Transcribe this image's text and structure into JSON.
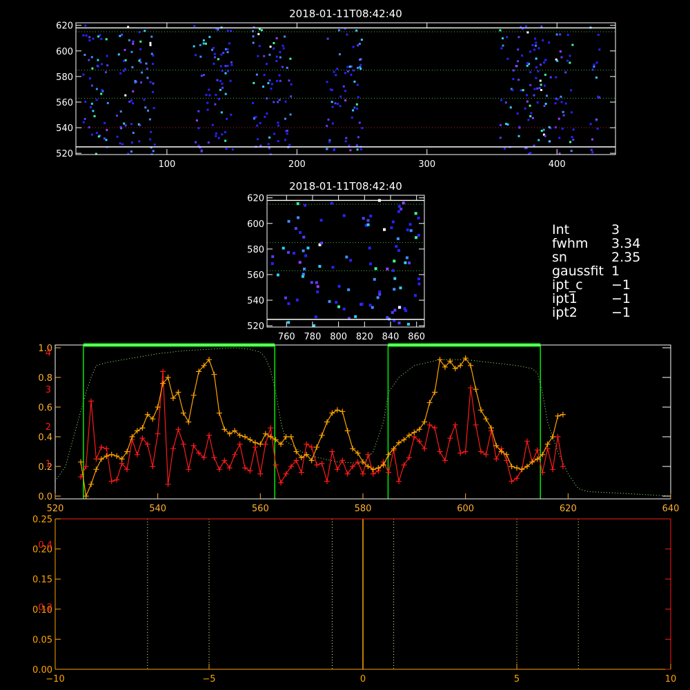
{
  "colors": {
    "background": "#000000",
    "axes": "#ffffff",
    "orange": "#ffa500",
    "red": "#ff1a1a",
    "green": "#00ff00",
    "green_dotted": "#a8ff7a",
    "red_dotted": "#cc2222",
    "yellow_dotted": "#ffff99",
    "amber_axis": "#ffb030"
  },
  "info": {
    "rows": [
      {
        "key": "Int",
        "value": "3"
      },
      {
        "key": "fwhm",
        "value": "3.34"
      },
      {
        "key": "sn",
        "value": "2.35"
      },
      {
        "key": "gaussfit",
        "value": "1"
      },
      {
        "key": "ipt_c",
        "value": "−1"
      },
      {
        "key": "ipt1",
        "value": "−1"
      },
      {
        "key": "ipt2",
        "value": "−1"
      }
    ]
  },
  "chart_data": [
    {
      "type": "heatmap",
      "title": "2018-01-11T08:42:40",
      "xlim": [
        30,
        445
      ],
      "ylim": [
        519,
        622
      ],
      "x_ticks": [
        100,
        200,
        300,
        400
      ],
      "y_ticks": [
        520,
        540,
        560,
        580,
        600,
        620
      ],
      "white_lines_y": [
        525,
        618
      ],
      "green_dotted_y": [
        563,
        585,
        615
      ],
      "red_dotted_y": [
        540
      ],
      "pixel_columns": [
        [
          35,
          55
        ],
        [
          60,
          90
        ],
        [
          120,
          150
        ],
        [
          165,
          195
        ],
        [
          222,
          250
        ],
        [
          355,
          395
        ],
        [
          398,
          412
        ],
        [
          425,
          432
        ]
      ]
    },
    {
      "type": "heatmap",
      "title": "2018-01-11T08:42:40",
      "xlim": [
        745,
        866
      ],
      "ylim": [
        519,
        622
      ],
      "x_ticks": [
        760,
        780,
        800,
        820,
        840,
        860
      ],
      "y_ticks": [
        520,
        540,
        560,
        580,
        600,
        620
      ],
      "white_lines_y": [
        525,
        618
      ],
      "green_dotted_y": [
        563,
        585,
        615
      ]
    },
    {
      "type": "line",
      "xlim": [
        520,
        640
      ],
      "ylim": [
        0,
        1.0
      ],
      "x_ticks": [
        520,
        540,
        560,
        580,
        600,
        620,
        640
      ],
      "y_ticks": [
        "0.0",
        "0.2",
        "0.4",
        "0.6",
        "0.8",
        "1.0"
      ],
      "right_axis_red_ticks": [
        {
          "label": "1",
          "at": 0.22
        },
        {
          "label": "2",
          "at": 0.47
        },
        {
          "label": "3",
          "at": 0.72
        },
        {
          "label": "4",
          "at": 0.97
        }
      ],
      "green_bands": [
        [
          525.5,
          562.8
        ],
        [
          584.9,
          614.6
        ]
      ],
      "orange_series": {
        "x": [
          525,
          526,
          527,
          528,
          529,
          530,
          531,
          532,
          533,
          534,
          535,
          536,
          537,
          538,
          539,
          540,
          541,
          542,
          543,
          544,
          545,
          546,
          547,
          548,
          549,
          550,
          551,
          552,
          553,
          554,
          555,
          556,
          557,
          558,
          559,
          560,
          561,
          562,
          563,
          564,
          565,
          566,
          567,
          568,
          569,
          570,
          571,
          572,
          573,
          574,
          575,
          576,
          577,
          578,
          579,
          580,
          581,
          582,
          583,
          584,
          585,
          586,
          587,
          588,
          589,
          590,
          591,
          592,
          593,
          594,
          595,
          596,
          597,
          598,
          599,
          600,
          601,
          602,
          603,
          604,
          605,
          606,
          607,
          608,
          609,
          610,
          611,
          612,
          613,
          614,
          615,
          616,
          617,
          618,
          619
        ],
        "y": [
          0.23,
          0.0,
          0.08,
          0.18,
          0.25,
          0.27,
          0.28,
          0.27,
          0.25,
          0.3,
          0.4,
          0.44,
          0.46,
          0.55,
          0.52,
          0.6,
          0.76,
          0.8,
          0.66,
          0.7,
          0.56,
          0.5,
          0.68,
          0.84,
          0.88,
          0.92,
          0.82,
          0.56,
          0.45,
          0.42,
          0.44,
          0.41,
          0.4,
          0.38,
          0.36,
          0.35,
          0.42,
          0.4,
          0.38,
          0.35,
          0.4,
          0.4,
          0.3,
          0.26,
          0.28,
          0.24,
          0.33,
          0.41,
          0.5,
          0.56,
          0.58,
          0.57,
          0.44,
          0.32,
          0.29,
          0.23,
          0.2,
          0.18,
          0.19,
          0.21,
          0.28,
          0.32,
          0.36,
          0.38,
          0.41,
          0.43,
          0.45,
          0.5,
          0.63,
          0.7,
          0.92,
          0.87,
          0.91,
          0.86,
          0.88,
          0.93,
          0.88,
          0.72,
          0.58,
          0.52,
          0.46,
          0.34,
          0.3,
          0.28,
          0.2,
          0.19,
          0.18,
          0.2,
          0.23,
          0.25,
          0.28,
          0.35,
          0.4,
          0.54,
          0.55
        ]
      },
      "red_series": {
        "x": [
          525,
          526,
          527,
          528,
          529,
          530,
          531,
          532,
          533,
          534,
          535,
          536,
          537,
          538,
          539,
          540,
          541,
          542,
          543,
          544,
          545,
          546,
          547,
          548,
          549,
          550,
          551,
          552,
          553,
          554,
          555,
          556,
          557,
          558,
          559,
          560,
          561,
          562,
          563,
          564,
          565,
          566,
          567,
          568,
          569,
          570,
          571,
          572,
          573,
          574,
          575,
          576,
          577,
          578,
          579,
          580,
          581,
          582,
          583,
          584,
          585,
          586,
          587,
          588,
          589,
          590,
          591,
          592,
          593,
          594,
          595,
          596,
          597,
          598,
          599,
          600,
          601,
          602,
          603,
          604,
          605,
          606,
          607,
          608,
          609,
          610,
          611,
          612,
          613,
          614,
          615,
          616,
          617,
          618,
          619
        ],
        "y": [
          0.13,
          0.2,
          0.64,
          0.25,
          0.33,
          0.32,
          0.1,
          0.11,
          0.22,
          0.18,
          0.38,
          0.28,
          0.39,
          0.35,
          0.2,
          0.42,
          0.84,
          0.08,
          0.32,
          0.45,
          0.35,
          0.18,
          0.34,
          0.29,
          0.26,
          0.41,
          0.26,
          0.18,
          0.24,
          0.19,
          0.28,
          0.35,
          0.19,
          0.17,
          0.33,
          0.15,
          0.35,
          0.46,
          0.21,
          0.09,
          0.15,
          0.2,
          0.24,
          0.16,
          0.35,
          0.33,
          0.21,
          0.22,
          0.1,
          0.3,
          0.18,
          0.24,
          0.15,
          0.2,
          0.23,
          0.15,
          0.28,
          0.15,
          0.17,
          0.23,
          0.16,
          0.31,
          0.1,
          0.21,
          0.26,
          0.4,
          0.37,
          0.32,
          0.48,
          0.46,
          0.3,
          0.24,
          0.39,
          0.48,
          0.29,
          0.3,
          0.73,
          0.48,
          0.3,
          0.28,
          0.44,
          0.25,
          0.32,
          0.24,
          0.1,
          0.12,
          0.18,
          0.37,
          0.23,
          0.31,
          0.16,
          0.32,
          0.18,
          0.4,
          0.2
        ]
      },
      "dotted_profile": {
        "x": [
          520,
          522,
          524,
          526,
          527,
          528,
          530,
          535,
          540,
          545,
          550,
          555,
          558,
          560,
          561,
          562,
          563,
          564,
          565,
          568,
          570,
          575,
          580,
          582,
          584,
          585,
          586,
          587,
          590,
          595,
          600,
          605,
          610,
          613,
          614,
          615,
          616,
          618,
          620,
          622,
          624,
          630,
          640
        ],
        "y": [
          0.1,
          0.2,
          0.45,
          0.7,
          0.8,
          0.88,
          0.9,
          0.93,
          0.96,
          0.98,
          0.99,
          1.0,
          0.99,
          0.97,
          0.93,
          0.85,
          0.7,
          0.5,
          0.37,
          0.3,
          0.27,
          0.23,
          0.22,
          0.3,
          0.5,
          0.7,
          0.75,
          0.8,
          0.88,
          0.92,
          0.92,
          0.9,
          0.88,
          0.86,
          0.83,
          0.7,
          0.5,
          0.3,
          0.15,
          0.05,
          0.03,
          0.02,
          0.0
        ]
      }
    },
    {
      "type": "line",
      "xlim": [
        -10,
        10
      ],
      "ylim": [
        0,
        0.25
      ],
      "x_ticks": [
        "−10",
        "−5",
        "0",
        "5",
        "10"
      ],
      "y_ticks": [
        "0.00",
        "0.05",
        "0.10",
        "0.15",
        "0.20",
        "0.25"
      ],
      "left_red_ticks": [
        {
          "label": "0.4",
          "at": 0.83
        },
        {
          "label": "0.2",
          "at": 0.415
        }
      ],
      "solid_orange_x": [
        0
      ],
      "yellow_dotted_x": [
        -7,
        -5,
        -1,
        1,
        5,
        7
      ]
    }
  ]
}
